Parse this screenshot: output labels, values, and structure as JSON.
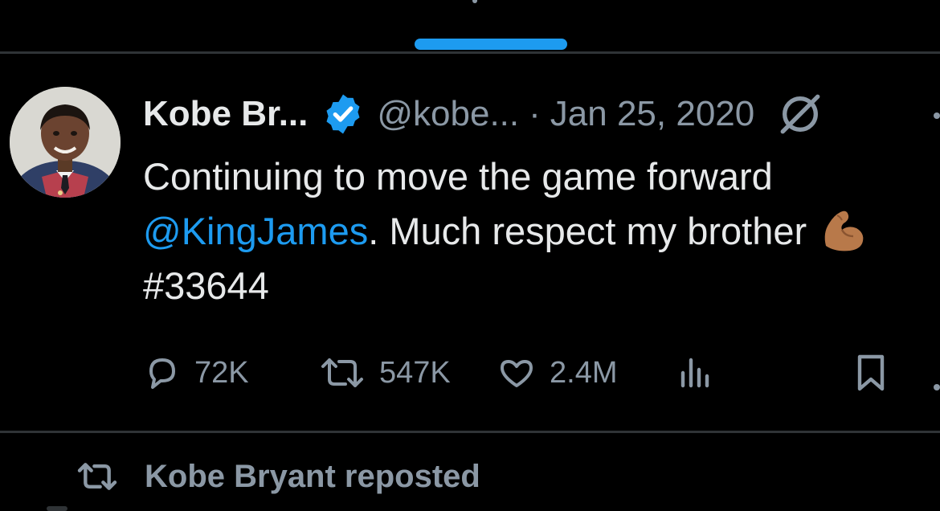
{
  "tweet": {
    "display_name": "Kobe Br...",
    "handle": "@kobe...",
    "separator": "·",
    "date": "Jan 25, 2020",
    "text_line1": "Continuing to move the game forward",
    "mention": "@KingJames",
    "text_line2_rest": ". Much respect my brother",
    "emoji": "flexed-biceps-emoji",
    "hashtag": "#33644"
  },
  "actions": {
    "replies": "72K",
    "reposts": "547K",
    "likes": "2.4M"
  },
  "next_tweet": {
    "repost_label": "Kobe Bryant reposted"
  },
  "icons": {
    "verified": "verified-badge-icon",
    "grok": "grok-icon",
    "reply": "reply-icon",
    "repost": "repost-icon",
    "like": "heart-icon",
    "views": "analytics-icon",
    "bookmark": "bookmark-icon"
  },
  "colors": {
    "background": "#000000",
    "text": "#e7e9ea",
    "secondary": "#8b98a5",
    "accent": "#1d9bf0",
    "divider": "#2f3336",
    "emoji_skin": "#b8794a"
  }
}
